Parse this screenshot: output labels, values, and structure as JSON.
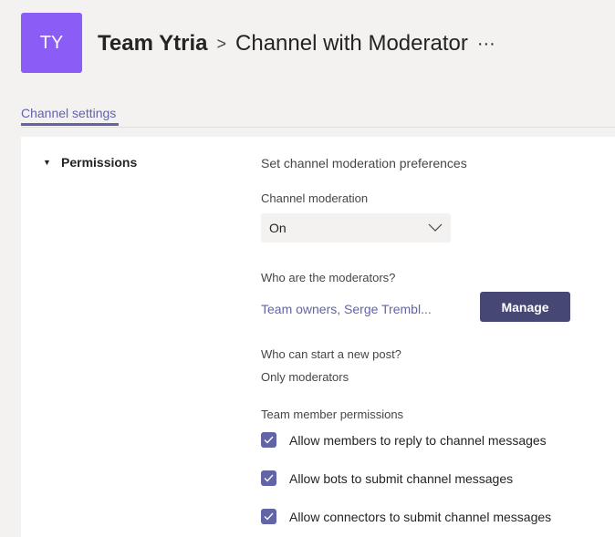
{
  "header": {
    "avatar_initials": "TY",
    "avatar_color": "#8b5cf6",
    "team_name": "Team Ytria",
    "separator": ">",
    "channel_name": "Channel with Moderator",
    "more": "···"
  },
  "tabs": [
    {
      "label": "Channel settings",
      "active": true
    }
  ],
  "permissions": {
    "section_title": "Permissions",
    "heading": "Set channel moderation preferences",
    "moderation_label": "Channel moderation",
    "moderation_value": "On",
    "moderators_label": "Who are the moderators?",
    "moderators_value": "Team owners, Serge Trembl...",
    "manage_label": "Manage",
    "new_post_label": "Who can start a new post?",
    "new_post_value": "Only moderators",
    "member_permissions_label": "Team member permissions",
    "checkboxes": [
      {
        "label": "Allow members to reply to channel messages",
        "checked": true
      },
      {
        "label": "Allow bots to submit channel messages",
        "checked": true
      },
      {
        "label": "Allow connectors to submit channel messages",
        "checked": true
      }
    ]
  },
  "colors": {
    "accent": "#6264a7",
    "button": "#464775"
  }
}
